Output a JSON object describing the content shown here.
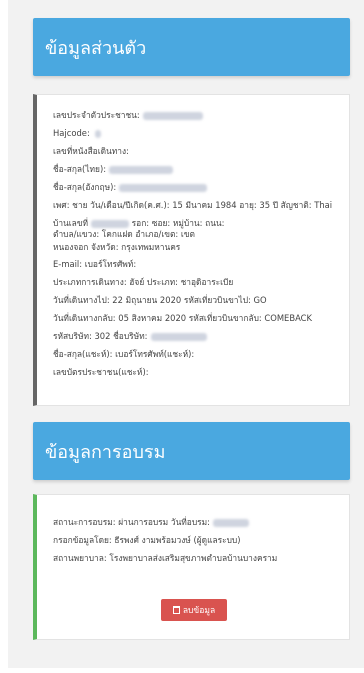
{
  "personal": {
    "title": "ข้อมูลส่วนตัว",
    "lines": [
      "เลขประจำตัวประชาชน:",
      "Hajcode: ",
      "เลขที่หนังสือเดินทาง:",
      "ชื่อ-สกุล(ไทย):",
      "ชื่อ-สกุล(อังกฤษ):",
      "เพศ: ชาย วัน/เดือน/ปีเกิด(ค.ศ.): 15 มีนาคม 1984 อายุ: 35 ปี สัญชาติ: Thai",
      "บ้านเลขที่",
      "ตำบล/แขวง: โคกแฝด อำเภอ/เขต: เขต",
      "หนองจอก จังหวัด: กรุงเทพมหานคร",
      "E-mail:  เบอร์โทรศัพท์:",
      "ประเภทการเดินทาง: ฮัจย์ ประเภท: ชาอุดิอาระเบีย",
      "วันที่เดินทางไป: 22 มิถุนายน 2020 รหัสเที่ยวบินขาไป: GO",
      "วันที่เดินทางกลับ: 05 สิงหาคม 2020 รหัสเที่ยวบินขากลับ: COMEBACK",
      "รหัสบริษัท: 302 ชื่อบริษัท:",
      "ชื่อ-สกุล(แชะห์):  เบอร์โทรศัพท์(แชะห์):",
      "เลขบัตรประชาชน(แชะห์):"
    ],
    "address_mid": "รอก: ซอย:  หมู่บ้าน:  ถนน:"
  },
  "training": {
    "title": "ข้อมูลการอบรม",
    "lines": [
      "สถานะการอบรม: ผ่านการอบรม วันที่อบรม:",
      "กรอกข้อมูลโดย: ธีรพงศ์ งามพร้อมวงษ์ (ผู้ดูแลระบบ)",
      "สถานพยาบาล: โรงพยาบาลส่งเสริมสุขภาพตำบลบ้านบางคราม"
    ],
    "delete_label": "ลบข้อมูล"
  }
}
